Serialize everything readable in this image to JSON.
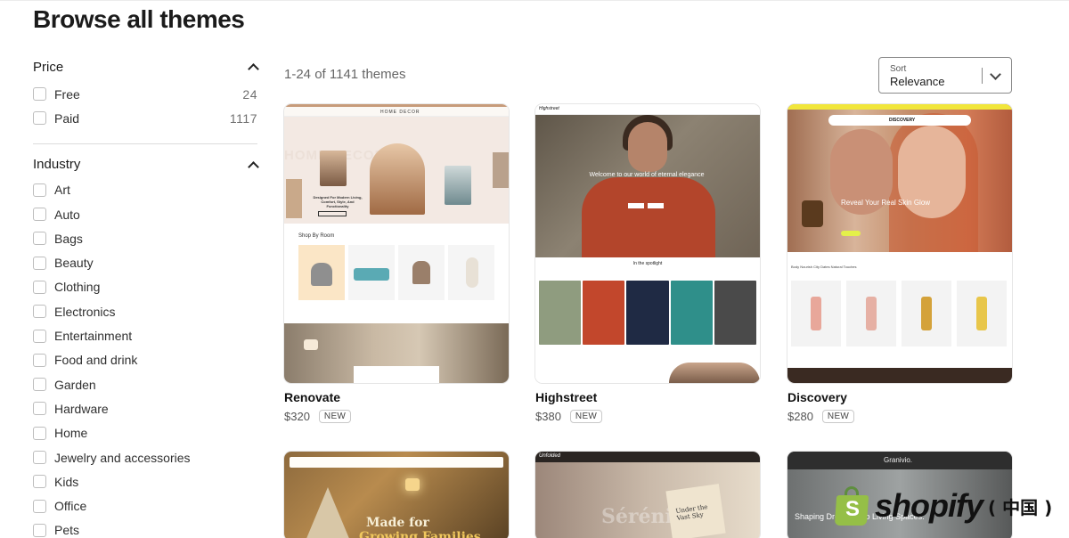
{
  "page": {
    "title": "Browse all themes"
  },
  "filters": {
    "price": {
      "title": "Price",
      "options": [
        {
          "label": "Free",
          "count": "24"
        },
        {
          "label": "Paid",
          "count": "1117"
        }
      ]
    },
    "industry": {
      "title": "Industry",
      "options": [
        "Art",
        "Auto",
        "Bags",
        "Beauty",
        "Clothing",
        "Electronics",
        "Entertainment",
        "Food and drink",
        "Garden",
        "Hardware",
        "Home",
        "Jewelry and accessories",
        "Kids",
        "Office",
        "Pets"
      ]
    }
  },
  "results": {
    "count_text": "1-24 of 1141 themes"
  },
  "sort": {
    "label": "Sort",
    "value": "Relevance"
  },
  "themes": [
    {
      "name": "Renovate",
      "price": "$320",
      "badge": "NEW",
      "preview": {
        "logo": "HOME DECOR",
        "watermark": "HOME DECOR",
        "headline": "Designed For Modern Living, Comfort, Style, And Functionality",
        "section": "Shop By Room"
      }
    },
    {
      "name": "Highstreet",
      "price": "$380",
      "badge": "NEW",
      "preview": {
        "logo": "Highstreet",
        "headline": "Welcome to our world of eternal elegance",
        "section": "In the spotlight"
      }
    },
    {
      "name": "Discovery",
      "price": "$280",
      "badge": "NEW",
      "preview": {
        "logo": "DISCOVERY",
        "headline": "Reveal Your Real Skin Glow",
        "tabs": "Body Nourish   City Dates   Natural Touches"
      }
    },
    {
      "name": "",
      "price": "",
      "badge": "",
      "preview": {
        "headline_1": "Made for",
        "headline_2": "Growing Families"
      }
    },
    {
      "name": "",
      "price": "",
      "badge": "",
      "preview": {
        "logo": "Unfolded",
        "headline": "Sérénité",
        "card": "Under the Vast Sky"
      }
    },
    {
      "name": "",
      "price": "",
      "badge": "",
      "preview": {
        "logo": "Granivio.",
        "headline": "Shaping Dreams Into Living Spaces."
      }
    }
  ],
  "watermark": {
    "word": "shopify",
    "suffix": "( 中国 )",
    "brand_color": "#95bf47"
  },
  "colors": {
    "text": "#1a1a1a",
    "muted": "#666666",
    "border": "#dcdcdc"
  }
}
